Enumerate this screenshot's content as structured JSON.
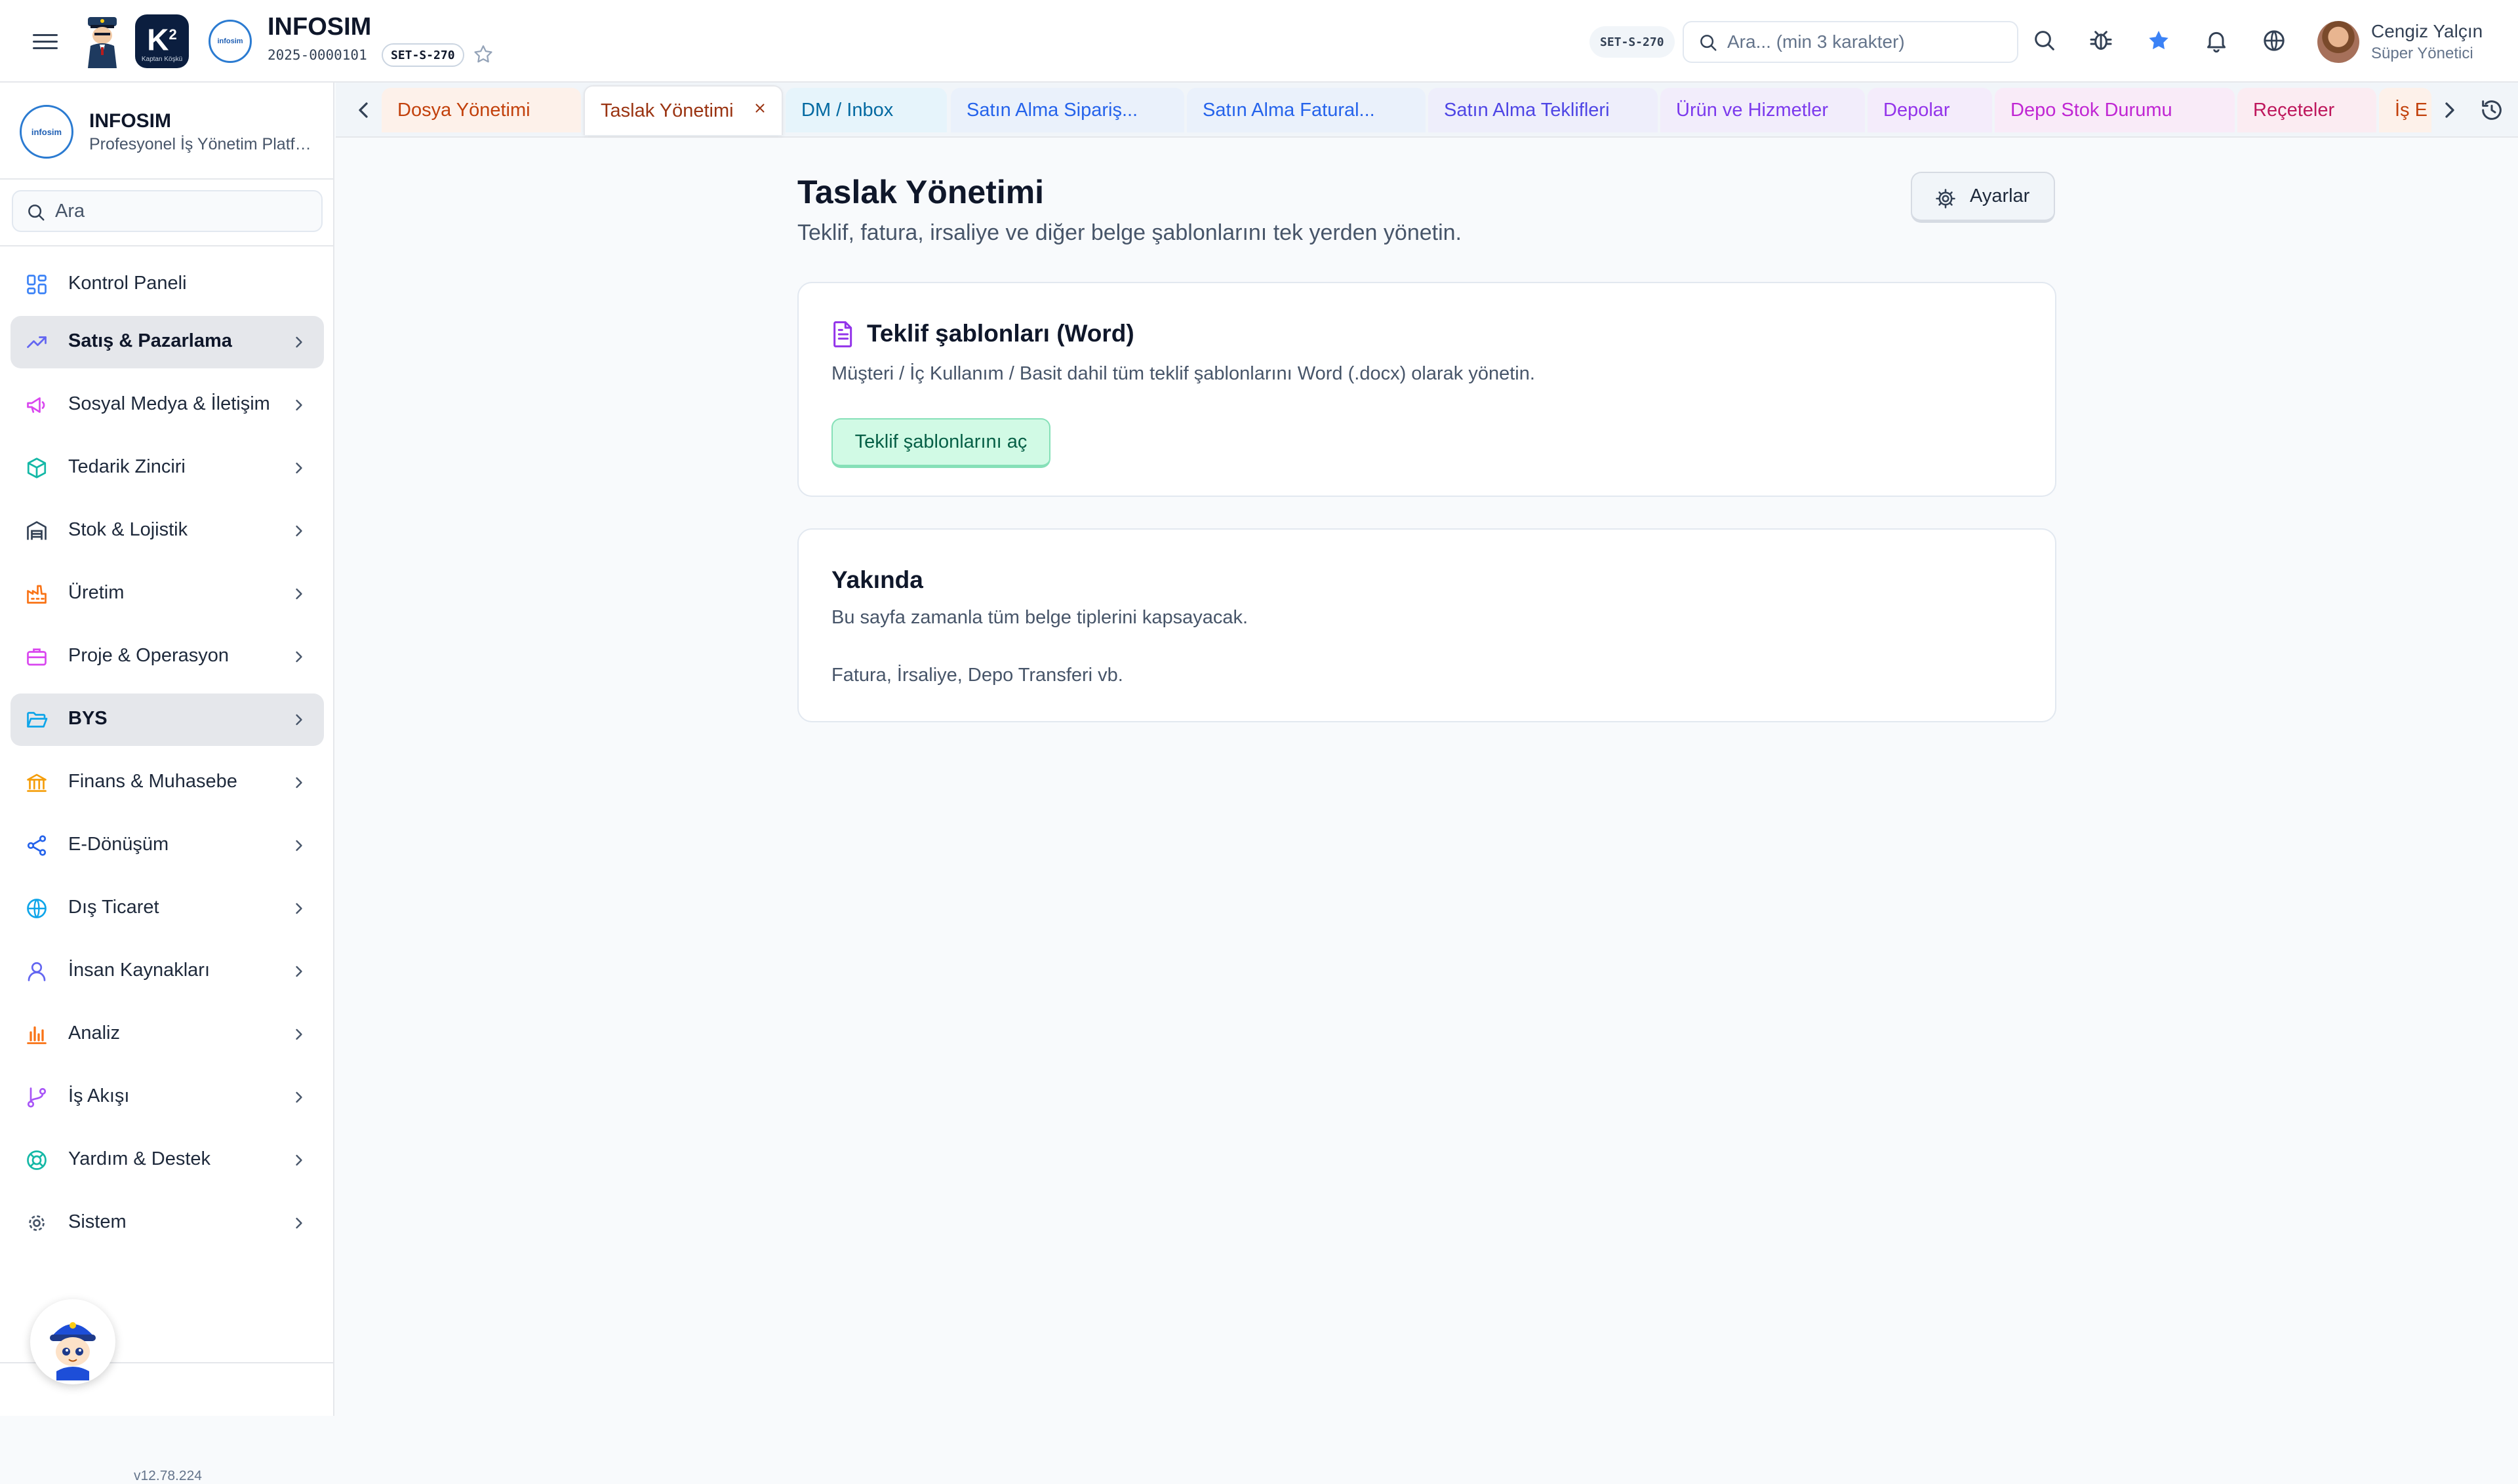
{
  "header": {
    "brand_title": "INFOSIM",
    "brand_code": "2025-0000101",
    "set_badge": "SET-S-270",
    "set_badge_right": "SET-S-270",
    "search_placeholder": "Ara... (min 3 karakter)",
    "user_name": "Cengiz Yalçın",
    "user_role": "Süper Yönetici",
    "k2_label": "K",
    "k2_sup": "2",
    "k2_caption": "Kaptan Köşkü",
    "logo_text": "infosim",
    "icons": [
      "hamburger-icon",
      "search-icon",
      "bug-icon",
      "star-icon",
      "bell-icon",
      "globe-icon"
    ],
    "accent_color": "#3b82f6"
  },
  "sidebar": {
    "title": "INFOSIM",
    "subtitle": "Profesyonel İş Yönetim Platformu",
    "logo_text": "infosim",
    "search_placeholder": "Ara",
    "items": [
      {
        "label": "Kontrol Paneli",
        "icon": "dashboard-icon",
        "color": "#3b82f6",
        "chevron": false,
        "active": false
      },
      {
        "label": "Satış & Pazarlama",
        "icon": "trending-up-icon",
        "color": "#6366f1",
        "chevron": true,
        "active": true
      },
      {
        "label": "Sosyal Medya & İletişim",
        "icon": "megaphone-icon",
        "color": "#d946ef",
        "chevron": true,
        "active": false
      },
      {
        "label": "Tedarik Zinciri",
        "icon": "package-icon",
        "color": "#14b8a6",
        "chevron": true,
        "active": false
      },
      {
        "label": "Stok & Lojistik",
        "icon": "warehouse-icon",
        "color": "#334155",
        "chevron": true,
        "active": false
      },
      {
        "label": "Üretim",
        "icon": "factory-icon",
        "color": "#f97316",
        "chevron": true,
        "active": false
      },
      {
        "label": "Proje & Operasyon",
        "icon": "briefcase-icon",
        "color": "#d946ef",
        "chevron": true,
        "active": false
      },
      {
        "label": "BYS",
        "icon": "folder-open-icon",
        "color": "#0ea5e9",
        "chevron": true,
        "active": true
      },
      {
        "label": "Finans & Muhasebe",
        "icon": "bank-icon",
        "color": "#f59e0b",
        "chevron": true,
        "active": false
      },
      {
        "label": "E-Dönüşüm",
        "icon": "share-icon",
        "color": "#2563eb",
        "chevron": true,
        "active": false
      },
      {
        "label": "Dış Ticaret",
        "icon": "globe-icon",
        "color": "#0ea5e9",
        "chevron": true,
        "active": false
      },
      {
        "label": "İnsan Kaynakları",
        "icon": "user-icon",
        "color": "#6366f1",
        "chevron": true,
        "active": false
      },
      {
        "label": "Analiz",
        "icon": "bar-chart-icon",
        "color": "#f97316",
        "chevron": true,
        "active": false
      },
      {
        "label": "İş Akışı",
        "icon": "git-branch-icon",
        "color": "#a855f7",
        "chevron": true,
        "active": false
      },
      {
        "label": "Yardım & Destek",
        "icon": "lifebuoy-icon",
        "color": "#14b8a6",
        "chevron": true,
        "active": false
      },
      {
        "label": "Sistem",
        "icon": "gear-icon",
        "color": "#475569",
        "chevron": true,
        "active": false
      }
    ],
    "version": "v12.78.224"
  },
  "tabs": [
    {
      "label": "Dosya Yönetimi",
      "color": "#c2410c",
      "bg": "#fdf1ea",
      "active": false
    },
    {
      "label": "Taslak Yönetimi",
      "color": "#9a3412",
      "bg": "#ffffff",
      "active": true
    },
    {
      "label": "DM / Inbox",
      "color": "#0369a1",
      "bg": "#e6f4fb",
      "active": false
    },
    {
      "label": "Satın Alma Sipariş...",
      "color": "#2563eb",
      "bg": "#eaf1fb",
      "active": false
    },
    {
      "label": "Satın Alma Fatural...",
      "color": "#2563eb",
      "bg": "#eaf1fb",
      "active": false
    },
    {
      "label": "Satın Alma Teklifleri",
      "color": "#4f46e5",
      "bg": "#eeeefb",
      "active": false
    },
    {
      "label": "Ürün ve Hizmetler",
      "color": "#7c3aed",
      "bg": "#f2edfb",
      "active": false
    },
    {
      "label": "Depolar",
      "color": "#9333ea",
      "bg": "#f4ecfb",
      "active": false
    },
    {
      "label": "Depo Stok Durumu",
      "color": "#c026d3",
      "bg": "#f9ebf8",
      "active": false
    },
    {
      "label": "Reçeteler",
      "color": "#be185d",
      "bg": "#fbecf2",
      "active": false
    },
    {
      "label": "İş E",
      "color": "#c2410c",
      "bg": "#fdf1ea",
      "active": false
    }
  ],
  "main": {
    "title": "Taslak Yönetimi",
    "subtitle": "Teklif, fatura, irsaliye ve diğer belge şablonlarını tek yerden yönetin.",
    "settings_label": "Ayarlar",
    "card1": {
      "title": "Teklif şablonları (Word)",
      "desc": "Müşteri / İç Kullanım / Basit dahil tüm teklif şablonlarını Word (.docx) olarak yönetin.",
      "button": "Teklif şablonlarını aç"
    },
    "card2": {
      "title": "Yakında",
      "desc": "Bu sayfa zamanla tüm belge tiplerini kapsayacak.",
      "desc2": "Fatura, İrsaliye, Depo Transferi vb."
    }
  }
}
